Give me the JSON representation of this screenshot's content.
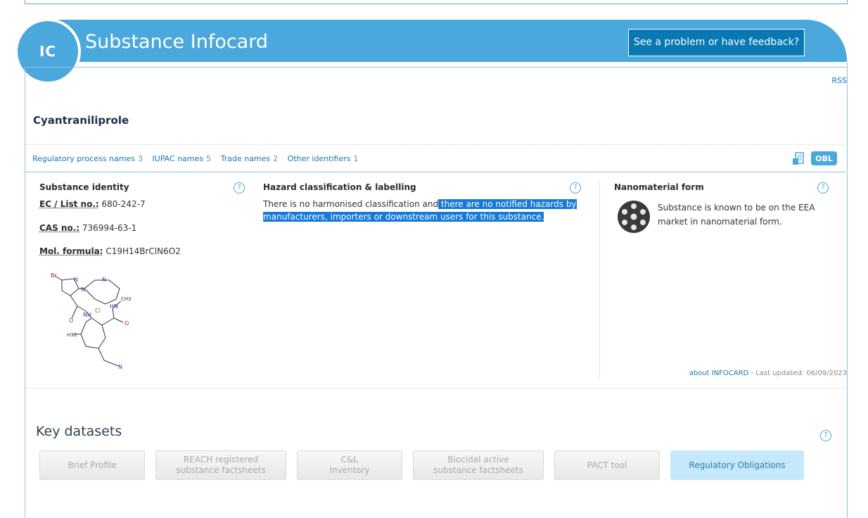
{
  "header": {
    "badge": "IC",
    "title": "Substance Infocard",
    "feedback_label": "See a problem or have feedback?"
  },
  "rss": "RSS",
  "substance_name": "Cyantraniliprole",
  "links": [
    {
      "label": "Regulatory process names",
      "count": "3"
    },
    {
      "label": "IUPAC names",
      "count": "5"
    },
    {
      "label": "Trade names",
      "count": "2"
    },
    {
      "label": "Other identifiers",
      "count": "1"
    }
  ],
  "obl_label": "OBL",
  "identity": {
    "title": "Substance identity",
    "ec_label": "EC / List no.:",
    "ec_value": "680-242-7",
    "cas_label": "CAS no.:",
    "cas_value": "736994-63-1",
    "formula_label": "Mol. formula:",
    "formula_value": "C19H14BrClN6O2"
  },
  "structure_atoms": {
    "br": "Br",
    "n1": "N",
    "n2": "N",
    "n3": "N",
    "cl": "Cl",
    "hn": "HN",
    "nh": "NH",
    "ch3": "CH3",
    "o1": "O",
    "o2": "O",
    "h3c": "H3C",
    "n4": "N"
  },
  "hazard": {
    "title": "Hazard classification & labelling",
    "text_plain": "There is no harmonised classification and",
    "text_selected": " there are no notified hazards by manufacturers, importers or downstream users for this substance. "
  },
  "nano": {
    "title": "Nanomaterial form",
    "text": "Substance is known to be on the EEA market in nanomaterial form."
  },
  "updated": {
    "link": "about INFOCARD",
    "text": " - Last updated: 06/09/2023"
  },
  "key_datasets": {
    "title": "Key datasets",
    "buttons": [
      {
        "line1": "Brief Profile",
        "line2": ""
      },
      {
        "line1": "REACH registered",
        "line2": "substance factsheets"
      },
      {
        "line1": "C&L",
        "line2": "Inventory"
      },
      {
        "line1": "Biocidal active",
        "line2": "substance factsheets"
      },
      {
        "line1": "PACT tool",
        "line2": ""
      },
      {
        "line1": "Regulatory Obligations",
        "line2": ""
      }
    ]
  },
  "help_glyph": "?",
  "colors": {
    "brand": "#4aa8dc",
    "feedback_bg": "#0a79b3",
    "selection": "#1479d9",
    "active_button": "#c5e8fb"
  }
}
